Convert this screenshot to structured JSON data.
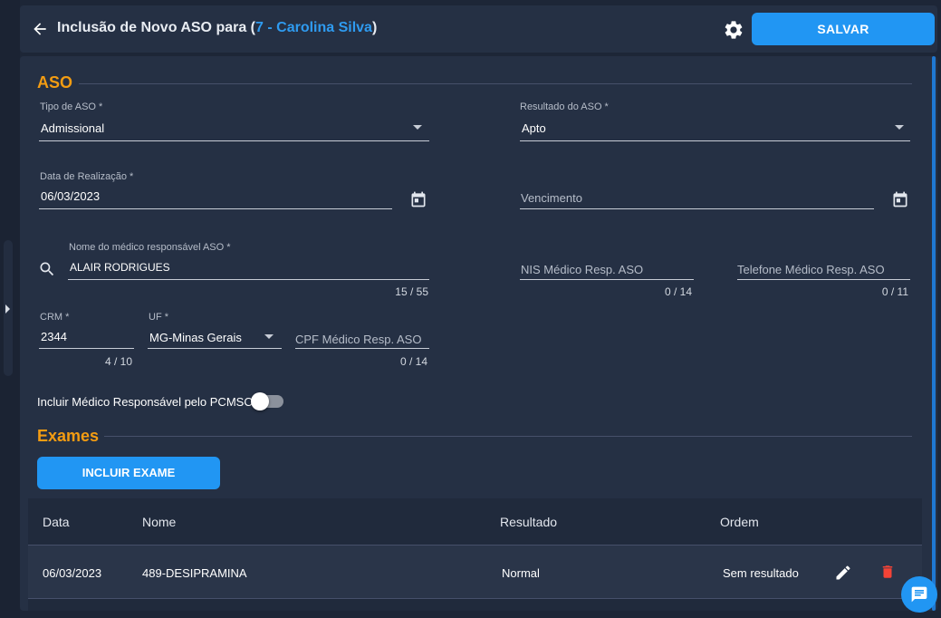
{
  "header": {
    "title_prefix": "Inclusão de Novo ASO para (",
    "employee": "7 - Carolina Silva",
    "title_suffix": ")",
    "save_label": "SALVAR"
  },
  "aso": {
    "section_title": "ASO",
    "tipo_label": "Tipo de ASO *",
    "tipo_value": "Admissional",
    "resultado_label": "Resultado do ASO *",
    "resultado_value": "Apto",
    "data_label": "Data de Realização *",
    "data_value": "06/03/2023",
    "vencimento_placeholder": "Vencimento",
    "medico_label": "Nome do médico responsável ASO *",
    "medico_value": "ALAIR RODRIGUES",
    "medico_counter": "15 / 55",
    "nis_placeholder": "NIS Médico Resp. ASO",
    "nis_counter": "0 / 14",
    "telefone_placeholder": "Telefone Médico Resp. ASO",
    "telefone_counter": "0 / 11",
    "crm_label": "CRM *",
    "crm_value": "2344",
    "crm_counter": "4 / 10",
    "uf_label": "UF *",
    "uf_value": "MG-Minas Gerais",
    "cpf_placeholder": "CPF Médico Resp. ASO",
    "cpf_counter": "0 / 14",
    "toggle_label": "Incluir Médico Responsável pelo PCMSO",
    "toggle_on": false
  },
  "exames": {
    "section_title": "Exames",
    "include_label": "INCLUIR EXAME",
    "columns": [
      "Data",
      "Nome",
      "Resultado",
      "Ordem"
    ],
    "rows": [
      {
        "data": "06/03/2023",
        "nome": "489-DESIPRAMINA",
        "resultado": "Normal",
        "ordem": "Sem resultado"
      }
    ]
  },
  "colors": {
    "accent": "#2196f3",
    "section": "#f39c12",
    "delete": "#f44336"
  },
  "icons": [
    "back-arrow-icon",
    "gear-icon",
    "calendar-icon",
    "search-icon",
    "edit-icon",
    "delete-icon",
    "chat-icon"
  ]
}
